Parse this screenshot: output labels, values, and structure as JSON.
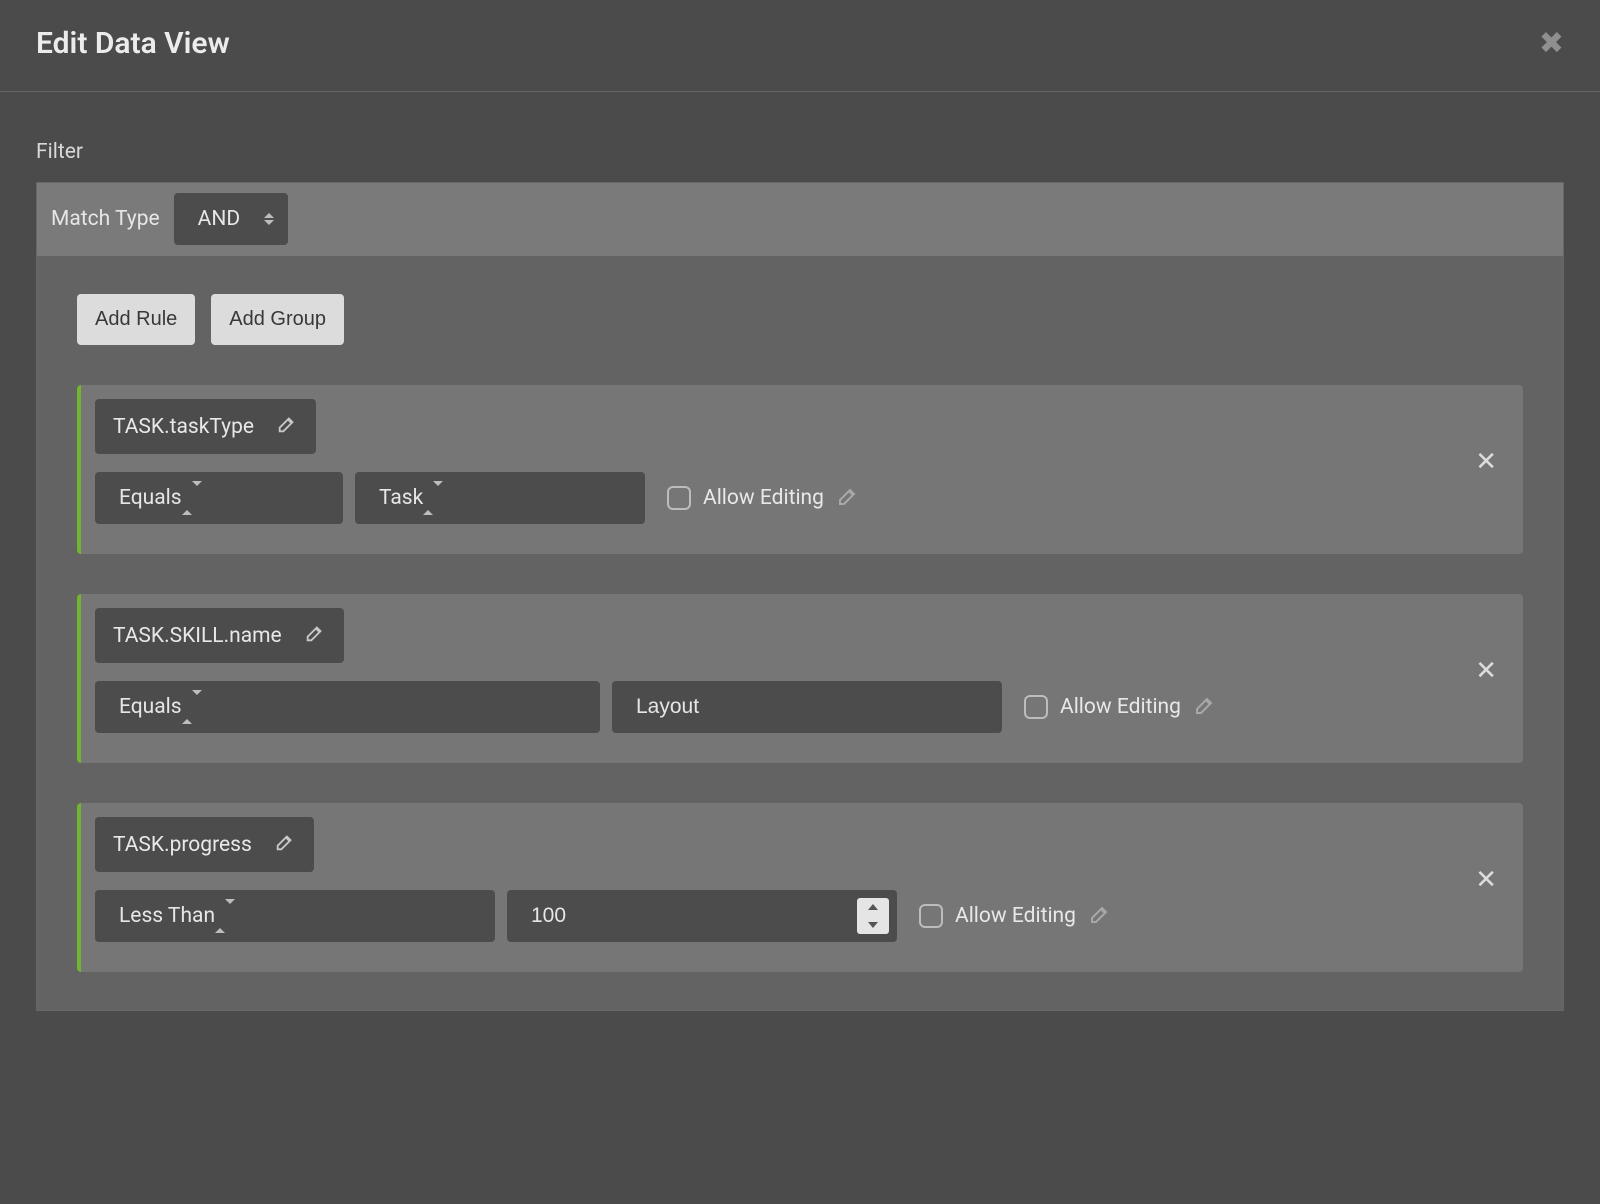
{
  "header": {
    "title": "Edit Data View"
  },
  "filter": {
    "label": "Filter",
    "match_type_label": "Match Type",
    "match_type_value": "AND",
    "add_rule_label": "Add Rule",
    "add_group_label": "Add Group",
    "allow_editing_label": "Allow Editing",
    "rules": [
      {
        "field": "TASK.taskType",
        "operator": "Equals",
        "value": "Task",
        "value_kind": "select"
      },
      {
        "field": "TASK.SKILL.name",
        "operator": "Equals",
        "value": "Layout",
        "value_kind": "text"
      },
      {
        "field": "TASK.progress",
        "operator": "Less Than",
        "value": "100",
        "value_kind": "number"
      }
    ]
  },
  "colors": {
    "accent_green": "#73b52e"
  }
}
